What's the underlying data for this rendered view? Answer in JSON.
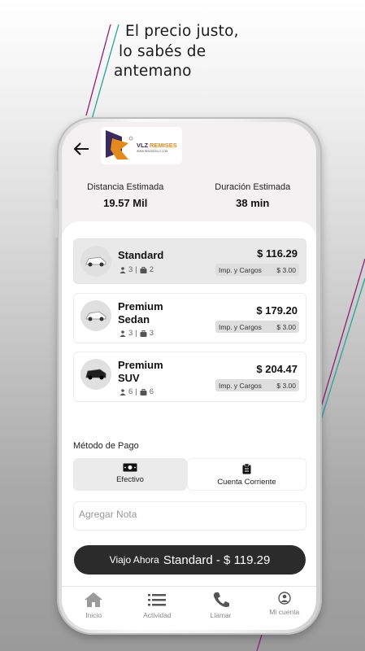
{
  "headline": {
    "line1": "El precio justo,",
    "line2": "lo sabés de",
    "line3": "antemano"
  },
  "colors": {
    "accent_purple": "#8e1f7a",
    "accent_teal": "#2aa39a",
    "dark": "#2b2b2b",
    "logo_orange": "#e38a1f"
  },
  "header": {
    "back_icon": "arrow-left-icon",
    "logo_name": "VLZ REMISES",
    "logo_url": "WWW.REMISESVLZ.COM"
  },
  "trip": {
    "distance_label": "Distancia Estimada",
    "distance_value": "19.57 Mil",
    "duration_label": "Duración Estimada",
    "duration_value": "38 min"
  },
  "options": [
    {
      "name": "Standard",
      "passengers": "3",
      "bags": "2",
      "price": "$ 116.29",
      "tax_label": "Imp. y Cargos",
      "tax_value": "$ 3.00",
      "selected": true
    },
    {
      "name": "Premium Sedan",
      "passengers": "3",
      "bags": "3",
      "price": "$ 179.20",
      "tax_label": "Imp. y Cargos",
      "tax_value": "$ 3.00",
      "selected": false
    },
    {
      "name": "Premium SUV",
      "passengers": "6",
      "bags": "6",
      "price": "$ 204.47",
      "tax_label": "Imp. y Cargos",
      "tax_value": "$ 3.00",
      "selected": false
    }
  ],
  "payment": {
    "title": "Método de Pago",
    "methods": [
      {
        "label": "Efectivo",
        "icon": "cash-icon",
        "selected": true
      },
      {
        "label": "Cuenta Corriente",
        "icon": "clipboard-icon",
        "selected": false
      }
    ]
  },
  "note": {
    "placeholder": "Agregar Nota"
  },
  "cta": {
    "prefix": "Viajo Ahora",
    "main": "Standard - $ 119.29"
  },
  "nav": [
    {
      "label": "Inicio",
      "icon": "home-icon"
    },
    {
      "label": "Actividad",
      "icon": "list-icon"
    },
    {
      "label": "Llamar",
      "icon": "phone-icon"
    },
    {
      "label": "Mi cuenta",
      "icon": "account-icon"
    }
  ]
}
